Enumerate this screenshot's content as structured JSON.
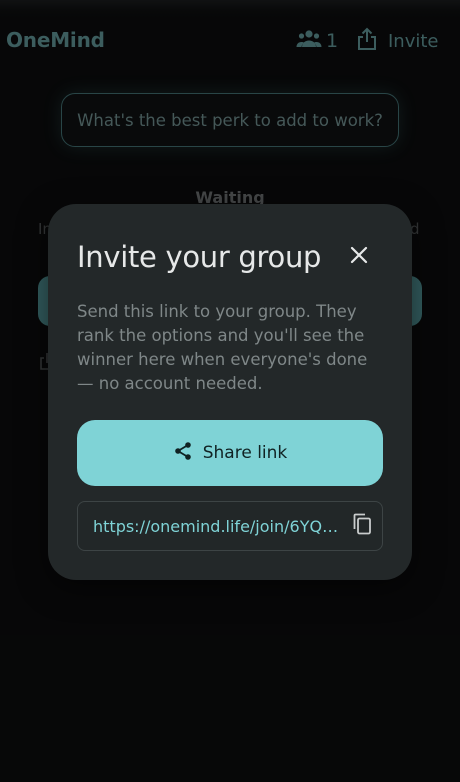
{
  "app": {
    "brand": "OneMind",
    "participant_count": "1",
    "invite_label": "Invite"
  },
  "background": {
    "question": "What's the best perk to add to work?",
    "status": "Waiting",
    "fragment_left": "In",
    "fragment_right": "d"
  },
  "dialog": {
    "title": "Invite your group",
    "body": "Send this link to your group. They rank the options and you'll see the winner here when everyone's done — no account needed.",
    "share_label": "Share link",
    "link": "https://onemind.life/join/6YQP…"
  },
  "icons": {
    "participants": "people-icon",
    "invite": "share-upload-icon",
    "close": "close-icon",
    "share": "share-icon",
    "copy": "copy-icon"
  },
  "colors": {
    "accent": "#7fd3d6",
    "brand": "#5d8f91",
    "dialog_bg": "#232829",
    "page_bg": "#0b0c0d"
  }
}
